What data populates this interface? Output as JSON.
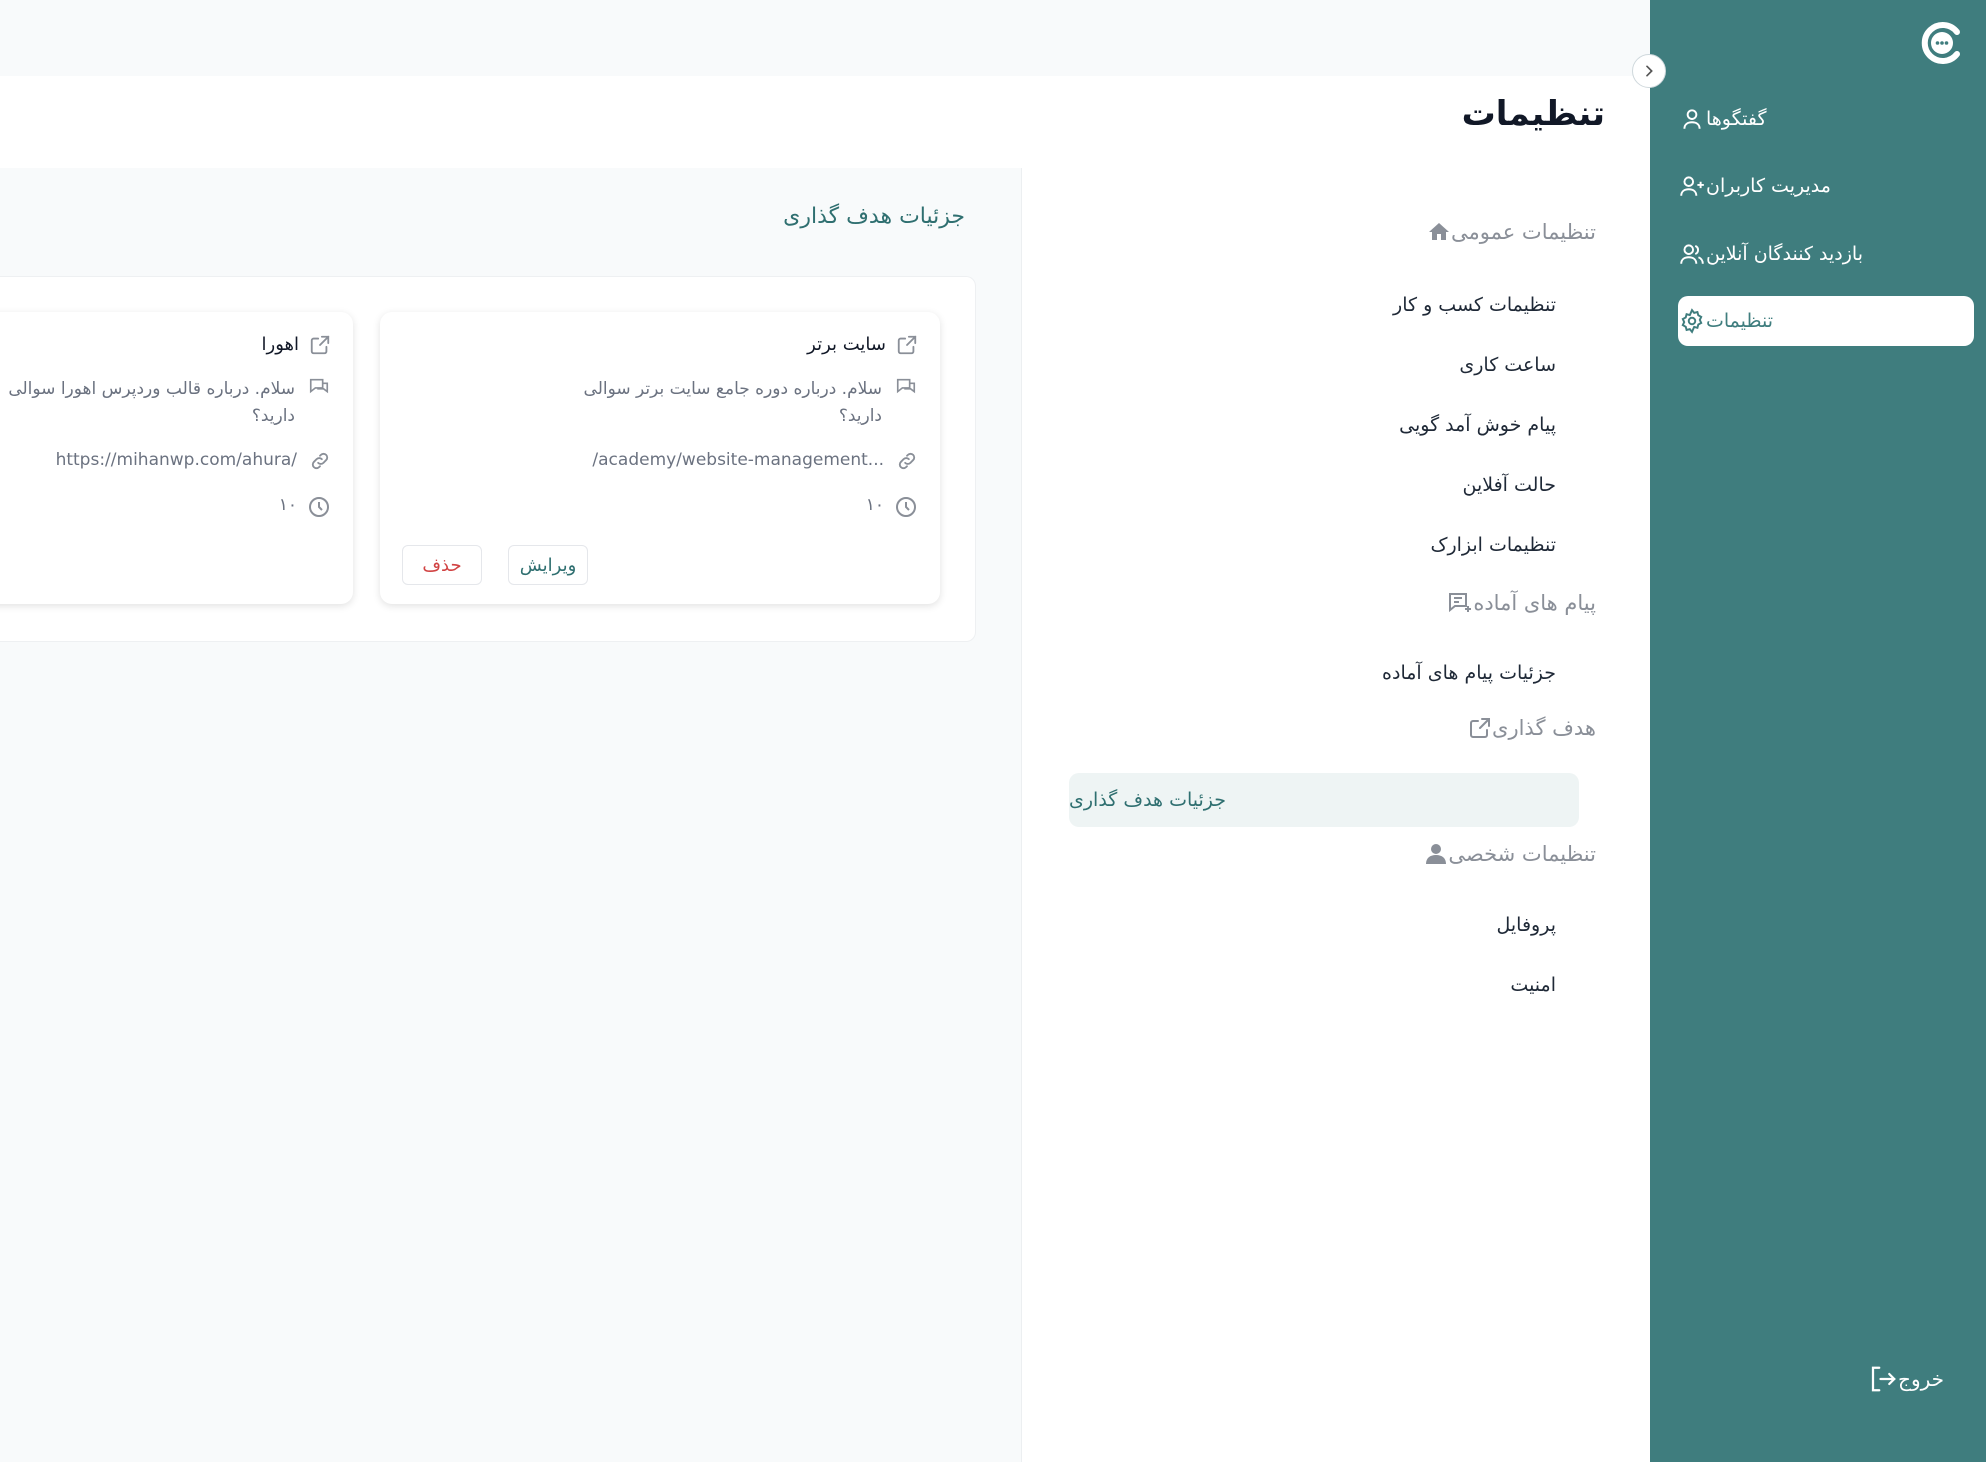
{
  "header": {
    "title": "تنظیمات"
  },
  "sidebar": {
    "items": [
      {
        "label": "گفتگوها",
        "icon": "user-icon"
      },
      {
        "label": "مدیریت کاربران",
        "icon": "user-plus-icon"
      },
      {
        "label": "بازدید کنندگان آنلاین",
        "icon": "users-icon"
      },
      {
        "label": "تنظیمات",
        "icon": "gear-icon",
        "active": true
      }
    ],
    "logout_label": "خروج"
  },
  "settings_menu": {
    "sections": [
      {
        "label": "تنظیمات عمومی",
        "icon": "home-icon",
        "items": [
          "تنظیمات کسب و کار",
          "ساعت کاری",
          "پیام خوش آمد گویی",
          "حالت آفلاین",
          "تنظیمات ابزارک"
        ]
      },
      {
        "label": "پیام های آماده",
        "icon": "message-add-icon",
        "items": [
          "جزئیات پیام های آماده"
        ]
      },
      {
        "label": "هدف گذاری",
        "icon": "external-link-icon",
        "items": [
          "جزئیات هدف گذاری"
        ]
      },
      {
        "label": "تنظیمات شخصی",
        "icon": "person-icon",
        "items": [
          "پروفایل",
          "امنیت"
        ]
      }
    ],
    "active_item": "جزئیات هدف گذاری"
  },
  "main": {
    "section_title": "جزئیات هدف گذاری",
    "cards": [
      {
        "title": "سایت برتر",
        "message": "سلام. درباره دوره جامع سایت برتر سوالی دارید؟",
        "link": "/academy/website-management...",
        "time": "۱۰",
        "edit_label": "ویرایش",
        "delete_label": "حذف"
      },
      {
        "title": "اهورا",
        "message": "سلام. درباره قالب وردپرس اهورا سوالی دارید؟",
        "link": "https://mihanwp.com/ahura/",
        "time": "۱۰"
      }
    ]
  },
  "colors": {
    "brand": "#3f7d7e",
    "accent_text": "#2f6f70",
    "danger": "#d14343"
  }
}
